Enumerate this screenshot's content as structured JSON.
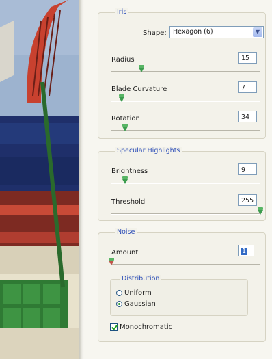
{
  "iris": {
    "title": "Iris",
    "shape_label": "Shape:",
    "shape_value": "Hexagon (6)",
    "radius": {
      "label": "Radius",
      "value": "15",
      "slider_fraction": 0.2
    },
    "blade_curvature": {
      "label": "Blade Curvature",
      "value": "7",
      "slider_fraction": 0.07
    },
    "rotation": {
      "label": "Rotation",
      "value": "34",
      "slider_fraction": 0.09
    }
  },
  "specular": {
    "title": "Specular Highlights",
    "brightness": {
      "label": "Brightness",
      "value": "9",
      "slider_fraction": 0.09
    },
    "threshold": {
      "label": "Threshold",
      "value": "255",
      "slider_fraction": 1.0
    }
  },
  "noise": {
    "title": "Noise",
    "amount": {
      "label": "Amount",
      "value": "1",
      "slider_fraction": 0.0
    },
    "distribution": {
      "title": "Distribution",
      "options": [
        {
          "label": "Uniform",
          "selected": false
        },
        {
          "label": "Gaussian",
          "selected": true
        }
      ]
    },
    "monochromatic": {
      "label": "Monochromatic",
      "checked": true
    }
  },
  "colors": {
    "group_title": "#2e4fb8",
    "slider_thumb": "#3c9c4e",
    "field_border": "#7f9db9"
  }
}
